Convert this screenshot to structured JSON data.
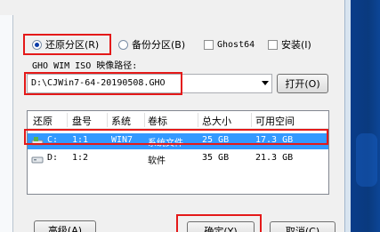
{
  "options": {
    "restore": {
      "label": "还原分区(R)",
      "selected": true
    },
    "backup": {
      "label": "备份分区(B)",
      "selected": false
    },
    "ghost64": {
      "label": "Ghost64",
      "checked": false
    },
    "install": {
      "label": "安装(I)",
      "checked": false
    }
  },
  "path_label": "GHO WIM ISO 映像路径:",
  "path_value": "D:\\CJWin7-64-20190508.GHO",
  "open_button": "打开(O)",
  "list": {
    "columns": [
      "还原",
      "盘号",
      "系统",
      "卷标",
      "总大小",
      "可用空间"
    ],
    "rows": [
      {
        "drive": "C:",
        "num": "1:1",
        "system": "WIN7",
        "label": "系统文件",
        "total": "25 GB",
        "free": "17.3 GB",
        "selected": true
      },
      {
        "drive": "D:",
        "num": "1:2",
        "system": "",
        "label": "软件",
        "total": "35 GB",
        "free": "21.3 GB",
        "selected": false
      }
    ]
  },
  "buttons": {
    "advanced": "高级(A)",
    "ok": "确定(Y)",
    "cancel": "取消(C)"
  },
  "colors": {
    "highlight_box": "#e41919",
    "selection": "#3399ff"
  }
}
